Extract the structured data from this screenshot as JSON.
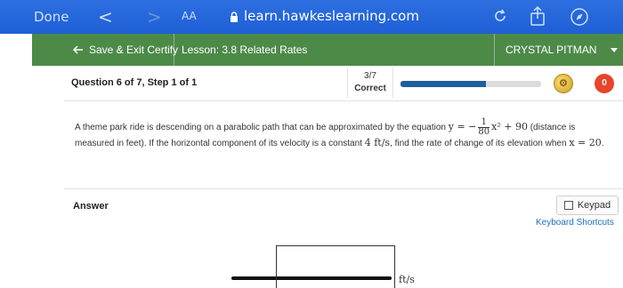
{
  "browser": {
    "done": "Done",
    "back": "<",
    "forward": ">",
    "text_size": "AA",
    "url": "learn.hawkeslearning.com"
  },
  "header": {
    "save_exit": "Save & Exit Certify",
    "lesson": "Lesson: 3.8 Related Rates",
    "user": "CRYSTAL PITMAN"
  },
  "question": {
    "title": "Question 6 of 7, Step 1 of 1",
    "score": "3/7",
    "status": "Correct",
    "progress_fraction": 0.61,
    "wrong_count": "0"
  },
  "problem": {
    "part1": "A theme park ride is descending on a parabolic path that can be approximated by the equation ",
    "eq_lhs": "y = −",
    "frac_num": "1",
    "frac_den": "80",
    "eq_rhs": "x² + 90",
    "part2": " (distance is measured in feet). If the horizontal component of its velocity is a constant ",
    "velocity": "4 ft/s",
    "part3": ", find the rate of change of its elevation when ",
    "when": "x = 20",
    "end": "."
  },
  "answer": {
    "label": "Answer",
    "keypad": "Keypad",
    "shortcuts": "Keyboard Shortcuts",
    "unit": "ft/s"
  },
  "colors": {
    "browser_bar": "#1e5fd6",
    "header_green": "#4d8a48",
    "progress": "#1d5e9c",
    "badge": "#e8442c",
    "link": "#1d6fc0"
  }
}
